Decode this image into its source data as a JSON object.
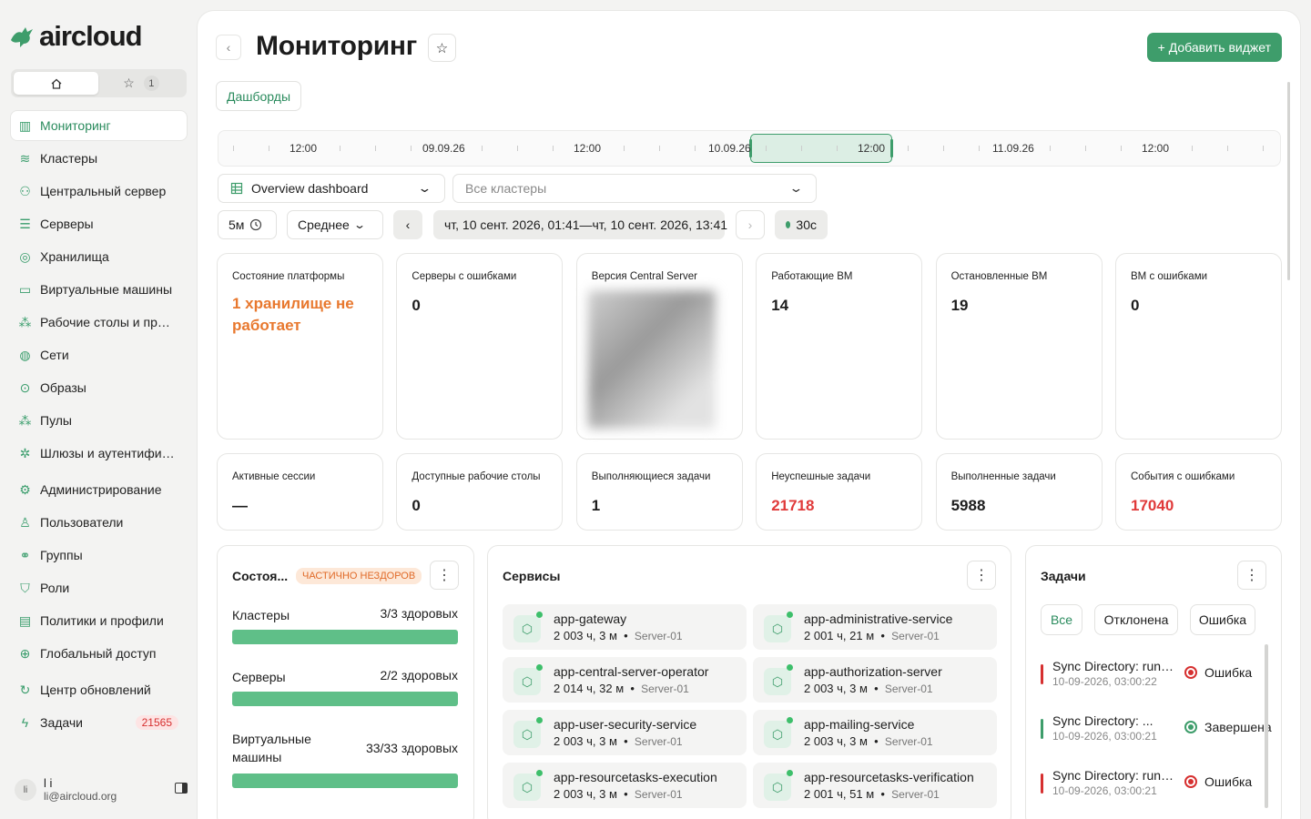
{
  "app": {
    "logo_text": "aircloud"
  },
  "sidebar": {
    "fav_count": "1",
    "items": [
      {
        "label": "Мониторинг",
        "icon": "chart-icon",
        "active": true
      },
      {
        "label": "Кластеры",
        "icon": "layers-icon"
      },
      {
        "label": "Центральный сервер",
        "icon": "central-server-icon"
      },
      {
        "label": "Серверы",
        "icon": "server-icon"
      },
      {
        "label": "Хранилища",
        "icon": "database-icon"
      },
      {
        "label": "Виртуальные машины",
        "icon": "monitor-icon"
      },
      {
        "label": "Рабочие столы и приложения",
        "icon": "apps-icon"
      },
      {
        "label": "Сети",
        "icon": "network-icon"
      },
      {
        "label": "Образы",
        "icon": "disc-icon"
      },
      {
        "label": "Пулы",
        "icon": "pools-icon"
      },
      {
        "label": "Шлюзы и аутентификация",
        "icon": "gateway-icon"
      },
      {
        "label": "Администрирование",
        "icon": "admin-icon"
      },
      {
        "label": "Пользователи",
        "icon": "user-icon"
      },
      {
        "label": "Группы",
        "icon": "group-icon"
      },
      {
        "label": "Роли",
        "icon": "shield-icon"
      },
      {
        "label": "Политики и профили",
        "icon": "policy-icon"
      },
      {
        "label": "Глобальный доступ",
        "icon": "globe-icon"
      },
      {
        "label": "Центр обновлений",
        "icon": "refresh-icon"
      },
      {
        "label": "Задачи",
        "icon": "bolt-icon",
        "badge": "21565"
      }
    ],
    "user": {
      "initials": "li",
      "name": "l i",
      "email": "li@aircloud.org"
    }
  },
  "header": {
    "title": "Мониторинг",
    "add_widget": "+ Добавить виджет",
    "dashboards": "Дашборды"
  },
  "timeline": {
    "labels": [
      "12:00",
      "09.09.26",
      "12:00",
      "10.09.26",
      "12:00",
      "11.09.26",
      "12:00"
    ]
  },
  "filters": {
    "dashboard": "Overview dashboard",
    "clusters_placeholder": "Все кластеры",
    "interval": "5м",
    "aggregation": "Среднее",
    "range": "чт, 10 сент. 2026, 01:41—чт, 10 сент. 2026, 13:41",
    "refresh": "30с"
  },
  "stats_row1": [
    {
      "label": "Состояние платформы",
      "value": "1 хранилище не работает",
      "tone": "orange"
    },
    {
      "label": "Серверы с ошибками",
      "value": "0"
    },
    {
      "label": "Версия Central Server",
      "value": ""
    },
    {
      "label": "Работающие ВМ",
      "value": "14"
    },
    {
      "label": "Остановленные ВМ",
      "value": "19"
    },
    {
      "label": "ВМ с ошибками",
      "value": "0"
    }
  ],
  "stats_row2": [
    {
      "label": "Активные сессии",
      "value": "—"
    },
    {
      "label": "Доступные рабочие столы",
      "value": "0"
    },
    {
      "label": "Выполняющиеся задачи",
      "value": "1"
    },
    {
      "label": "Неуспешные задачи",
      "value": "21718",
      "tone": "red"
    },
    {
      "label": "Выполненные задачи",
      "value": "5988"
    },
    {
      "label": "События с ошибками",
      "value": "17040",
      "tone": "red"
    }
  ],
  "health": {
    "title": "Состоя...",
    "status": "ЧАСТИЧНО НЕЗДОРОВ",
    "rows": [
      {
        "name": "Кластеры",
        "value": "3/3 здоровых",
        "fraction": 1
      },
      {
        "name": "Серверы",
        "value": "2/2 здоровых",
        "fraction": 1
      },
      {
        "name": "Виртуальные машины",
        "value": "33/33 здоровых",
        "fraction": 1
      }
    ]
  },
  "services": {
    "title": "Сервисы",
    "items": [
      {
        "name": "app-gateway",
        "uptime": "2 003 ч, 3 м",
        "server": "Server-01"
      },
      {
        "name": "app-administrative-service",
        "uptime": "2 001 ч, 21 м",
        "server": "Server-01"
      },
      {
        "name": "app-central-server-operator",
        "uptime": "2 014 ч, 32 м",
        "server": "Server-01"
      },
      {
        "name": "app-authorization-server",
        "uptime": "2 003 ч, 3 м",
        "server": "Server-01"
      },
      {
        "name": "app-user-security-service",
        "uptime": "2 003 ч, 3 м",
        "server": "Server-01"
      },
      {
        "name": "app-mailing-service",
        "uptime": "2 003 ч, 3 м",
        "server": "Server-01"
      },
      {
        "name": "app-resourcetasks-execution",
        "uptime": "2 003 ч, 3 м",
        "server": "Server-01"
      },
      {
        "name": "app-resourcetasks-verification",
        "uptime": "2 001 ч, 51 м",
        "server": "Server-01"
      }
    ]
  },
  "tasks": {
    "title": "Задачи",
    "filters": [
      "Все",
      "Отклонена",
      "Ошибка"
    ],
    "items": [
      {
        "name": "Sync Directory: running",
        "time": "10-09-2026, 03:00:22",
        "status": "Ошибка",
        "color": "#d63030"
      },
      {
        "name": "Sync Directory: ...",
        "time": "10-09-2026, 03:00:21",
        "status": "Завершена",
        "color": "#3e9d6b"
      },
      {
        "name": "Sync Directory: running",
        "time": "10-09-2026, 03:00:21",
        "status": "Ошибка",
        "color": "#d63030"
      }
    ]
  },
  "colors": {
    "accent": "#3e9d6b",
    "error": "#d63030",
    "warning": "#e8782e"
  }
}
